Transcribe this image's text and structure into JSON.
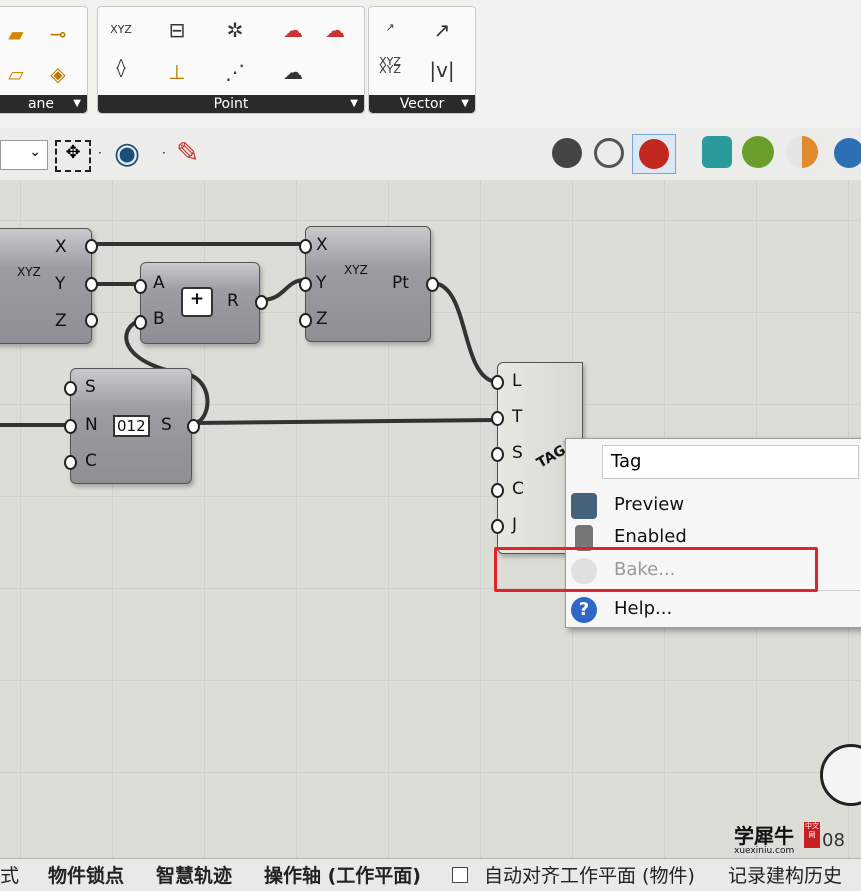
{
  "ribbon": {
    "panels": [
      {
        "label": "ane"
      },
      {
        "label": "Point"
      },
      {
        "label": "Vector"
      }
    ],
    "icons": [
      "plane-icon",
      "plane-align-icon",
      "xyz-deconstruct-icon",
      "xyz-construct-icon",
      "grid-icon",
      "point-align-icon",
      "network-icon",
      "graph-icon",
      "cloud-icon",
      "cloud-remove-icon",
      "cloud-add-icon",
      "vector-xyz-icon",
      "vector-icon",
      "vector-amplitude-icon"
    ]
  },
  "toolbar": {
    "dropdown_value": ""
  },
  "canvas": {
    "deconstruct": {
      "outputs": [
        "X",
        "Y",
        "Z"
      ],
      "icon_text": "XYZ"
    },
    "addition": {
      "inputs": [
        "A",
        "B"
      ],
      "output": "R",
      "icon_text": "+"
    },
    "construct_point": {
      "inputs": [
        "X",
        "Y",
        "Z"
      ],
      "output": "Pt",
      "icon_text": "XYZ"
    },
    "series": {
      "inputs": [
        "S",
        "N",
        "C"
      ],
      "output": "S",
      "icon_text": "012"
    },
    "tag": {
      "inputs": [
        "L",
        "T",
        "S",
        "C",
        "J"
      ],
      "icon_text": "TAG"
    }
  },
  "context_menu": {
    "name_field": "Tag",
    "items": [
      {
        "label": "Preview",
        "enabled": true
      },
      {
        "label": "Enabled",
        "enabled": true
      },
      {
        "label": "Bake...",
        "enabled": false
      },
      {
        "label": "Help...",
        "enabled": true
      }
    ],
    "highlight_color": "#e1242a"
  },
  "statusbar": {
    "items": [
      "式",
      "物件锁点",
      "智慧轨迹",
      "操作轴 (工作平面)",
      "自动对齐工作平面 (物件)",
      "记录建构历史"
    ],
    "watermark": {
      "name": "学犀牛",
      "badge": "中文网",
      "url": "xuexiniu.com"
    },
    "number": "08"
  }
}
